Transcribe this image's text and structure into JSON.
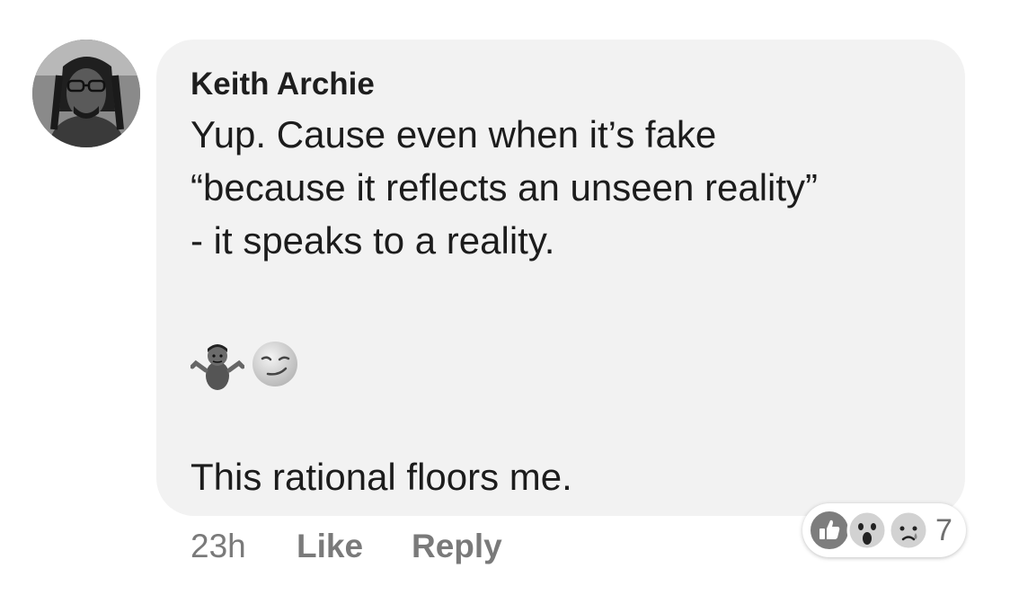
{
  "comment": {
    "author": "Keith Archie",
    "lines": [
      "Yup. Cause even when it’s fake",
      "“because it reflects an unseen reality”",
      "- it speaks to a reality.",
      "This rational floors me."
    ],
    "emojis": [
      "person-shrugging-emoji",
      "smirking-face-emoji"
    ]
  },
  "footer": {
    "time": "23h",
    "like_label": "Like",
    "reply_label": "Reply"
  },
  "reactions": {
    "icons": [
      "like-reaction-icon",
      "wow-reaction-icon",
      "sad-reaction-icon"
    ],
    "count": "7"
  }
}
